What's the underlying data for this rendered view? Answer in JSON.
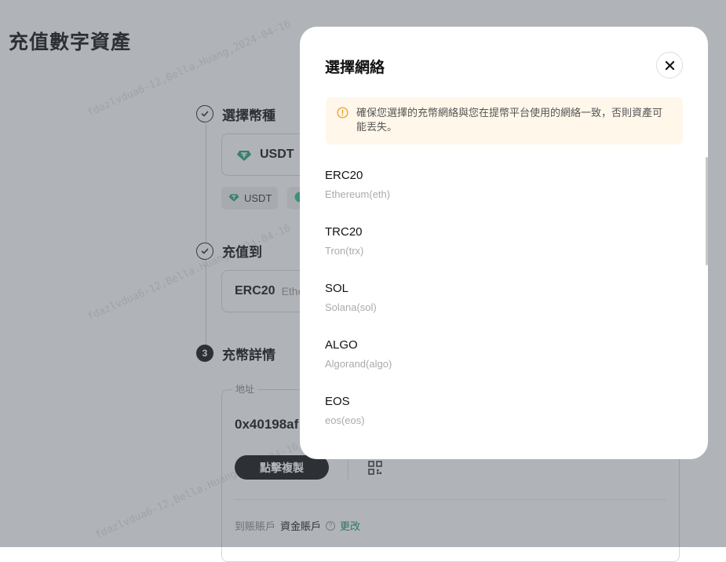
{
  "page": {
    "title": "充值數字資產",
    "watermark": "fdazlvdua6-12,Bella.Huang,2024-04-16"
  },
  "steps": [
    {
      "label": "選擇幣種"
    },
    {
      "label": "充值到"
    },
    {
      "number": "3",
      "label": "充幣詳情"
    }
  ],
  "coin": {
    "symbol": "USDT",
    "name_partial": "T"
  },
  "quick_chips": [
    {
      "label": "USDT"
    },
    {
      "label": ""
    }
  ],
  "network_field": {
    "name": "ERC20",
    "sub_partial": "Ethe"
  },
  "address": {
    "legend": "地址",
    "value_partial": "0x40198af",
    "copy_label": "點擊複製"
  },
  "account": {
    "label": "到賬賬戶",
    "value": "資金賬戶",
    "help_glyph": "?",
    "change_link": "更改"
  },
  "modal": {
    "title": "選擇網絡",
    "warning": "確保您選擇的充幣網絡與您在提幣平台使用的網絡一致，否則資產可能丟失。",
    "networks": [
      {
        "name": "ERC20",
        "sub": "Ethereum(eth)"
      },
      {
        "name": "TRC20",
        "sub": "Tron(trx)"
      },
      {
        "name": "SOL",
        "sub": "Solana(sol)"
      },
      {
        "name": "ALGO",
        "sub": "Algorand(algo)"
      },
      {
        "name": "EOS",
        "sub": "eos(eos)"
      }
    ]
  },
  "colors": {
    "tether": "#26a17b",
    "link": "#0f8f6f",
    "warning_bg": "#fff7ea",
    "warning_icon": "#f0a020"
  }
}
